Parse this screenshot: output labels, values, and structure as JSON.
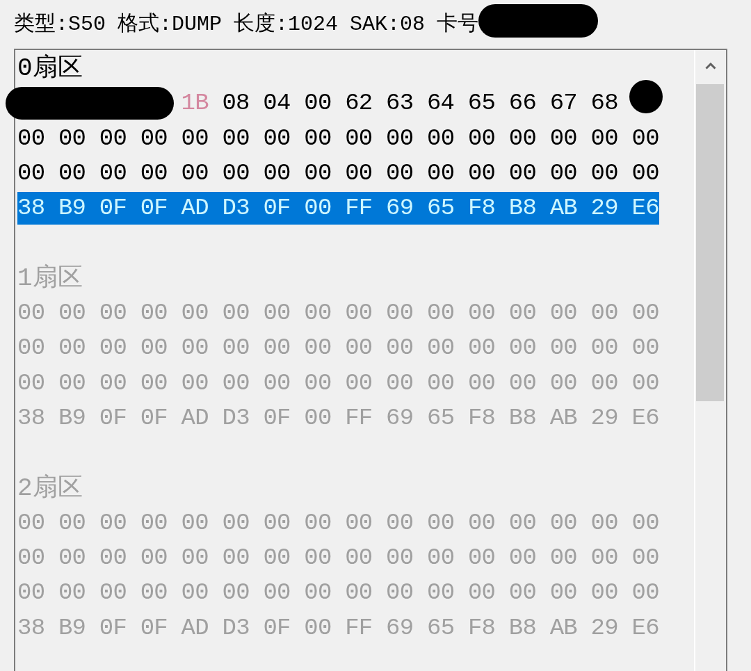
{
  "header": {
    "fields": [
      {
        "text": "类型:S50",
        "redacted": false
      },
      {
        "text": "格式:DUMP",
        "redacted": false
      },
      {
        "text": "长度:1024",
        "redacted": false
      },
      {
        "text": "SAK:08",
        "redacted": false
      },
      {
        "text": "卡号",
        "redacted": true
      }
    ]
  },
  "sectors": [
    {
      "label": "0扇区",
      "dimmed": false,
      "blocks": [
        {
          "selected": false,
          "segments": [
            {
              "kind": "redacted"
            },
            {
              "kind": "redacted"
            },
            {
              "kind": "redacted"
            },
            {
              "kind": "redacted"
            },
            {
              "kind": "bytes",
              "text": "1B",
              "color": "#d4879f"
            },
            {
              "kind": "bytes",
              "text": "08 04 00 62 63 64 65 66 67 68"
            },
            {
              "kind": "redacted"
            }
          ]
        },
        {
          "selected": false,
          "text": "00 00 00 00 00 00 00 00 00 00 00 00 00 00 00 00"
        },
        {
          "selected": false,
          "text": "00 00 00 00 00 00 00 00 00 00 00 00 00 00 00 00"
        },
        {
          "selected": true,
          "text": "38 B9 0F 0F AD D3 0F 00 FF 69 65 F8 B8 AB 29 E6"
        }
      ]
    },
    {
      "label": "1扇区",
      "dimmed": true,
      "blocks": [
        {
          "selected": false,
          "text": "00 00 00 00 00 00 00 00 00 00 00 00 00 00 00 00"
        },
        {
          "selected": false,
          "text": "00 00 00 00 00 00 00 00 00 00 00 00 00 00 00 00"
        },
        {
          "selected": false,
          "text": "00 00 00 00 00 00 00 00 00 00 00 00 00 00 00 00"
        },
        {
          "selected": false,
          "text": "38 B9 0F 0F AD D3 0F 00 FF 69 65 F8 B8 AB 29 E6"
        }
      ]
    },
    {
      "label": "2扇区",
      "dimmed": true,
      "blocks": [
        {
          "selected": false,
          "text": "00 00 00 00 00 00 00 00 00 00 00 00 00 00 00 00"
        },
        {
          "selected": false,
          "text": "00 00 00 00 00 00 00 00 00 00 00 00 00 00 00 00"
        },
        {
          "selected": false,
          "text": "00 00 00 00 00 00 00 00 00 00 00 00 00 00 00 00"
        },
        {
          "selected": false,
          "text": "38 B9 0F 0F AD D3 0F 00 FF 69 65 F8 B8 AB 29 E6"
        }
      ]
    }
  ]
}
